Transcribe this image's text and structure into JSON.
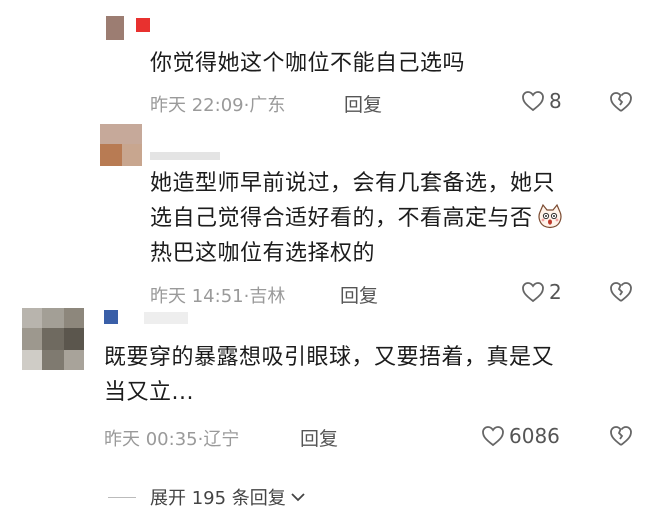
{
  "comments": [
    {
      "text": "你觉得她这个咖位不能自己选吗",
      "time": "昨天 22:09",
      "region": "广东",
      "reply": "回复",
      "likes": "8"
    },
    {
      "text_lines": [
        "她造型师早前说过，会有几套备选，她只",
        "选自己觉得合适好看的，不看高定与否",
        "热巴这咖位有选择权的"
      ],
      "time": "昨天 14:51",
      "region": "吉林",
      "reply": "回复",
      "likes": "2"
    },
    {
      "text_lines": [
        "既要穿的暴露想吸引眼球，又要捂着，真是又",
        "当又立..."
      ],
      "time": "昨天 00:35",
      "region": "辽宁",
      "reply": "回复",
      "likes": "6086"
    }
  ],
  "expand": {
    "label": "展开 195 条回复"
  },
  "colors": {
    "meta": "#9a9a9a",
    "text": "#1c1c1c",
    "badge_red": "#e8312f",
    "badge_blue": "#3a5fa8"
  }
}
